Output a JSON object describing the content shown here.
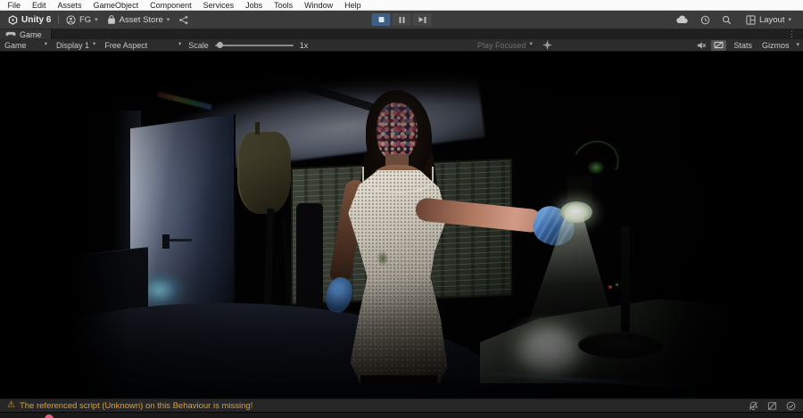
{
  "menubar": {
    "items": [
      "File",
      "Edit",
      "Assets",
      "GameObject",
      "Component",
      "Services",
      "Jobs",
      "Tools",
      "Window",
      "Help"
    ]
  },
  "toolbar": {
    "unity_version": "Unity 6",
    "separator": "|",
    "account_label": "FG",
    "asset_store_label": "Asset Store",
    "layout_label": "Layout"
  },
  "tabbar": {
    "game_tab": "Game"
  },
  "game_toolbar": {
    "view_dropdown": "Game",
    "display_dropdown": "Display 1",
    "aspect_dropdown": "Free Aspect",
    "scale_label": "Scale",
    "scale_value": "1x",
    "play_focused_label": "Play Focused",
    "stats_label": "Stats",
    "gizmos_label": "Gizmos"
  },
  "statusbar": {
    "warning_text": "The referenced script (Unknown) on this Behaviour is missing!"
  },
  "icons": {
    "chevron_down": "▾",
    "more_vertical": "⋮",
    "warning": "⚠"
  },
  "colors": {
    "play_active_bg": "#3e5f83",
    "warning_text": "#dba13f",
    "menubar_bg": "#fbfbfb",
    "toolbar_bg": "#3b3b3b",
    "tabbar_bg": "#1f1f1f",
    "game_toolbar_bg": "#2c2c2c",
    "statusbar_bg": "#262626",
    "bottombar_bg": "#191919",
    "glove_blue": "#3a68a8",
    "door_light": "#d9e1ed",
    "lamp_glow": "#eef4e6"
  }
}
